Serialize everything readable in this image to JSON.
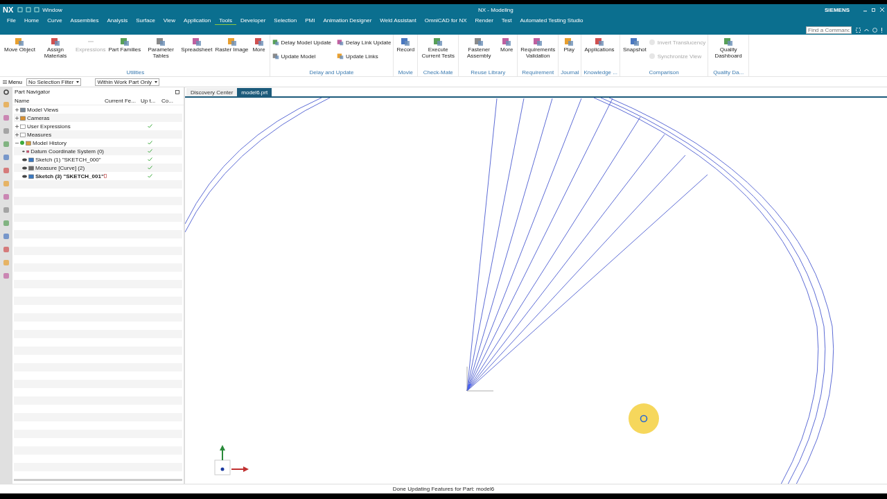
{
  "title_bar": {
    "logo": "NX",
    "quick_access_menu": "Window",
    "title": "NX - Modeling",
    "brand": "SIEMENS",
    "command_search": {
      "placeholder": "Find a Command"
    }
  },
  "tabs": [
    {
      "label": "File",
      "selected": false
    },
    {
      "label": "Home",
      "selected": false
    },
    {
      "label": "Curve",
      "selected": false
    },
    {
      "label": "Assemblies",
      "selected": false
    },
    {
      "label": "Analysis",
      "selected": false
    },
    {
      "label": "Surface",
      "selected": false
    },
    {
      "label": "View",
      "selected": false
    },
    {
      "label": "Application",
      "selected": false
    },
    {
      "label": "Tools",
      "selected": true
    },
    {
      "label": "Developer",
      "selected": false
    },
    {
      "label": "Selection",
      "selected": false
    },
    {
      "label": "PMI",
      "selected": false
    },
    {
      "label": "Animation Designer",
      "selected": false
    },
    {
      "label": "Weld Assistant",
      "selected": false
    },
    {
      "label": "OmniCAD for NX",
      "selected": false
    },
    {
      "label": "Render",
      "selected": false
    },
    {
      "label": "Test",
      "selected": false
    },
    {
      "label": "Automated Testing Studio",
      "selected": false
    }
  ],
  "ribbon": [
    {
      "label": "Utilities",
      "items": [
        {
          "label": "Move Object",
          "kind": "large",
          "disabled": false
        },
        {
          "label": "Assign Materials",
          "kind": "large",
          "disabled": false
        },
        {
          "label": "Expressions",
          "kind": "large",
          "disabled": true
        },
        {
          "label": "Part Families",
          "kind": "large",
          "disabled": false
        },
        {
          "label": "Parameter Tables",
          "kind": "large",
          "disabled": false
        },
        {
          "label": "Spreadsheet",
          "kind": "large",
          "disabled": false
        },
        {
          "label": "Raster Image",
          "kind": "large",
          "disabled": false
        },
        {
          "label": "More",
          "kind": "large",
          "disabled": false
        }
      ]
    },
    {
      "label": "Delay and Update",
      "items": [
        {
          "label": "Delay Model Update",
          "kind": "small",
          "disabled": false
        },
        {
          "label": "Update Model",
          "kind": "small",
          "disabled": false
        },
        {
          "label": "Delay Link Update",
          "kind": "small",
          "disabled": false
        },
        {
          "label": "Update Links",
          "kind": "small",
          "disabled": false
        }
      ]
    },
    {
      "label": "Movie",
      "items": [
        {
          "label": "Record",
          "kind": "large",
          "disabled": false
        }
      ]
    },
    {
      "label": "Check-Mate",
      "items": [
        {
          "label": "Execute Current Tests",
          "kind": "large",
          "disabled": false
        }
      ]
    },
    {
      "label": "Reuse Library",
      "items": [
        {
          "label": "Fastener Assembly",
          "kind": "large",
          "disabled": false
        },
        {
          "label": "More",
          "kind": "large",
          "disabled": false
        }
      ]
    },
    {
      "label": "Requirement",
      "items": [
        {
          "label": "Requirements Validation",
          "kind": "large",
          "disabled": false
        }
      ]
    },
    {
      "label": "Journal",
      "items": [
        {
          "label": "Play",
          "kind": "large",
          "disabled": false
        }
      ]
    },
    {
      "label": "Knowledge ...",
      "items": [
        {
          "label": "Applications",
          "kind": "large",
          "disabled": false
        }
      ]
    },
    {
      "label": "Comparison",
      "items": [
        {
          "label": "Snapshot",
          "kind": "large",
          "disabled": false
        },
        {
          "label": "Invert Translucency",
          "kind": "small",
          "disabled": true
        },
        {
          "label": "Synchronize View",
          "kind": "small",
          "disabled": true
        }
      ]
    },
    {
      "label": "Quality Da...",
      "items": [
        {
          "label": "Quality Dashboard",
          "kind": "large",
          "disabled": false
        }
      ]
    }
  ],
  "selection_bar": {
    "menu": "Menu",
    "filter": "No Selection Filter",
    "scope": "Within Work Part Only"
  },
  "part_navigator": {
    "title": "Part Navigator",
    "columns": [
      "Name",
      "Current Fe...",
      "Up t...",
      "Co..."
    ],
    "rows": [
      {
        "name": "Model Views",
        "kind": "views",
        "expanded": false,
        "up_to_date": false,
        "current": false
      },
      {
        "name": "Cameras",
        "kind": "cameras",
        "expanded": false,
        "up_to_date": false,
        "current": false
      },
      {
        "name": "User Expressions",
        "kind": "folder",
        "expanded": false,
        "up_to_date": true,
        "current": false
      },
      {
        "name": "Measures",
        "kind": "folder",
        "expanded": false,
        "up_to_date": false,
        "current": false
      },
      {
        "name": "Model History",
        "kind": "history",
        "expanded": true,
        "up_to_date": true,
        "current": false,
        "children": [
          {
            "name": "Datum Coordinate System (0)",
            "kind": "datum",
            "up_to_date": true,
            "current": false
          },
          {
            "name": "Sketch (1) \"SKETCH_000\"",
            "kind": "sketch",
            "up_to_date": true,
            "current": false
          },
          {
            "name": "Measure [Curve] (2)",
            "kind": "measure",
            "up_to_date": true,
            "current": false
          },
          {
            "name": "Sketch (3) \"SKETCH_001\"",
            "kind": "sketch",
            "up_to_date": true,
            "current": true
          }
        ]
      }
    ]
  },
  "document_tabs": [
    {
      "label": "Discovery Center",
      "selected": false
    },
    {
      "label": "model6.prt",
      "selected": true
    }
  ],
  "status_bar": {
    "message": "Done Updating Features for Part: model6"
  }
}
